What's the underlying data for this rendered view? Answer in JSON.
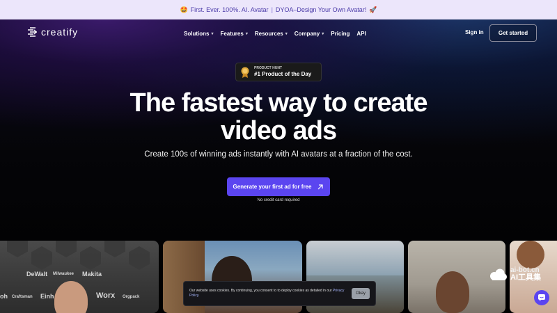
{
  "announcement": {
    "emoji": "🤩",
    "text": "First. Ever. 100%. AI. Avatar",
    "separator": "|",
    "link": "DYOA–Design Your Own Avatar!",
    "emoji2": "🚀"
  },
  "nav": {
    "logo": "creatify",
    "menu": [
      {
        "label": "Solutions",
        "has_caret": true
      },
      {
        "label": "Features",
        "has_caret": true
      },
      {
        "label": "Resources",
        "has_caret": true
      },
      {
        "label": "Company",
        "has_caret": true
      },
      {
        "label": "Pricing",
        "has_caret": false
      },
      {
        "label": "API",
        "has_caret": false
      }
    ],
    "signin": "Sign in",
    "get_started": "Get started"
  },
  "badge": {
    "small": "PRODUCT HUNT",
    "big": "#1 Product of the Day"
  },
  "hero": {
    "headline_1": "The fastest way to create",
    "headline_2": "video ads",
    "subtitle": "Create 100s of winning ads instantly with AI avatars at a fraction of the cost.",
    "cta": "Generate your first ad for free",
    "note": "No credit card required"
  },
  "card1_brands": [
    "DeWalt",
    "Milwaukee",
    "Makita",
    "Craftsman",
    "Einh",
    "Worx",
    "Orgpack",
    "oh"
  ],
  "cookie": {
    "text": "Our website uses cookies. By continuing, you consent to to deploy cookies as detailed in our",
    "link": "Privacy Policy",
    "end": ".",
    "button": "Okay"
  },
  "watermark": {
    "line1": "ai-bot.cn",
    "line2": "AI工具集"
  },
  "colors": {
    "accent": "#5b45f0",
    "announce_bg": "#ece6fb",
    "announce_text": "#4a3aa8"
  }
}
